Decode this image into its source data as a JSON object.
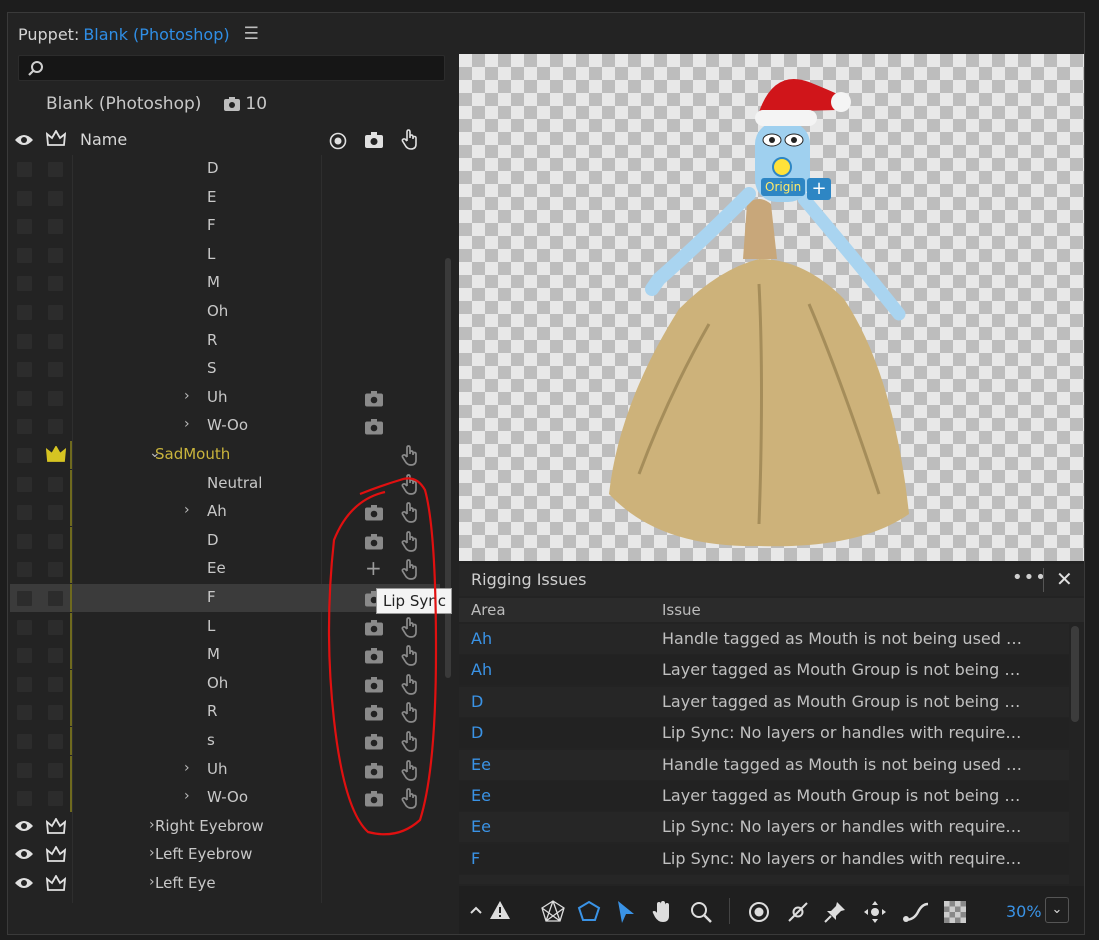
{
  "panel": {
    "title_prefix": "Puppet:",
    "title_link": "Blank (Photoshop)"
  },
  "search": {
    "placeholder": ""
  },
  "puppet": {
    "name": "Blank (Photoshop)",
    "count": "10"
  },
  "columns": {
    "name": "Name"
  },
  "layers": [
    {
      "name": "D",
      "indent": 3,
      "group": false,
      "expand": "",
      "cam": false,
      "hand": false,
      "plus": false,
      "eye": false,
      "crown": false,
      "yline": false,
      "sel": false
    },
    {
      "name": "E",
      "indent": 3,
      "group": false,
      "expand": "",
      "cam": false,
      "hand": false,
      "plus": false,
      "eye": false,
      "crown": false,
      "yline": false,
      "sel": false
    },
    {
      "name": "F",
      "indent": 3,
      "group": false,
      "expand": "",
      "cam": false,
      "hand": false,
      "plus": false,
      "eye": false,
      "crown": false,
      "yline": false,
      "sel": false
    },
    {
      "name": "L",
      "indent": 3,
      "group": false,
      "expand": "",
      "cam": false,
      "hand": false,
      "plus": false,
      "eye": false,
      "crown": false,
      "yline": false,
      "sel": false
    },
    {
      "name": "M",
      "indent": 3,
      "group": false,
      "expand": "",
      "cam": false,
      "hand": false,
      "plus": false,
      "eye": false,
      "crown": false,
      "yline": false,
      "sel": false
    },
    {
      "name": "Oh",
      "indent": 3,
      "group": false,
      "expand": "",
      "cam": false,
      "hand": false,
      "plus": false,
      "eye": false,
      "crown": false,
      "yline": false,
      "sel": false
    },
    {
      "name": "R",
      "indent": 3,
      "group": false,
      "expand": "",
      "cam": false,
      "hand": false,
      "plus": false,
      "eye": false,
      "crown": false,
      "yline": false,
      "sel": false
    },
    {
      "name": "S",
      "indent": 3,
      "group": false,
      "expand": "",
      "cam": false,
      "hand": false,
      "plus": false,
      "eye": false,
      "crown": false,
      "yline": false,
      "sel": false
    },
    {
      "name": "Uh",
      "indent": 3,
      "group": false,
      "expand": "›",
      "cam": true,
      "hand": false,
      "plus": false,
      "eye": false,
      "crown": false,
      "yline": false,
      "sel": false
    },
    {
      "name": "W-Oo",
      "indent": 3,
      "group": false,
      "expand": "›",
      "cam": true,
      "hand": false,
      "plus": false,
      "eye": false,
      "crown": false,
      "yline": false,
      "sel": false
    },
    {
      "name": "SadMouth",
      "indent": 2,
      "group": true,
      "expand": "⌄",
      "cam": false,
      "hand": true,
      "plus": false,
      "eye": false,
      "crown": true,
      "yline": true,
      "sel": false
    },
    {
      "name": "Neutral",
      "indent": 3,
      "group": false,
      "expand": "",
      "cam": false,
      "hand": true,
      "plus": false,
      "eye": false,
      "crown": false,
      "yline": true,
      "sel": false
    },
    {
      "name": "Ah",
      "indent": 3,
      "group": false,
      "expand": "›",
      "cam": true,
      "hand": true,
      "plus": false,
      "eye": false,
      "crown": false,
      "yline": true,
      "sel": false
    },
    {
      "name": "D",
      "indent": 3,
      "group": false,
      "expand": "",
      "cam": true,
      "hand": true,
      "plus": false,
      "eye": false,
      "crown": false,
      "yline": true,
      "sel": false
    },
    {
      "name": "Ee",
      "indent": 3,
      "group": false,
      "expand": "",
      "cam": false,
      "hand": true,
      "plus": true,
      "eye": false,
      "crown": false,
      "yline": true,
      "sel": false
    },
    {
      "name": "F",
      "indent": 3,
      "group": false,
      "expand": "",
      "cam": true,
      "hand": true,
      "plus": false,
      "eye": false,
      "crown": false,
      "yline": true,
      "sel": true
    },
    {
      "name": "L",
      "indent": 3,
      "group": false,
      "expand": "",
      "cam": true,
      "hand": true,
      "plus": false,
      "eye": false,
      "crown": false,
      "yline": true,
      "sel": false
    },
    {
      "name": "M",
      "indent": 3,
      "group": false,
      "expand": "",
      "cam": true,
      "hand": true,
      "plus": false,
      "eye": false,
      "crown": false,
      "yline": true,
      "sel": false
    },
    {
      "name": "Oh",
      "indent": 3,
      "group": false,
      "expand": "",
      "cam": true,
      "hand": true,
      "plus": false,
      "eye": false,
      "crown": false,
      "yline": true,
      "sel": false
    },
    {
      "name": "R",
      "indent": 3,
      "group": false,
      "expand": "",
      "cam": true,
      "hand": true,
      "plus": false,
      "eye": false,
      "crown": false,
      "yline": true,
      "sel": false
    },
    {
      "name": "s",
      "indent": 3,
      "group": false,
      "expand": "",
      "cam": true,
      "hand": true,
      "plus": false,
      "eye": false,
      "crown": false,
      "yline": true,
      "sel": false
    },
    {
      "name": "Uh",
      "indent": 3,
      "group": false,
      "expand": "›",
      "cam": true,
      "hand": true,
      "plus": false,
      "eye": false,
      "crown": false,
      "yline": true,
      "sel": false
    },
    {
      "name": "W-Oo",
      "indent": 3,
      "group": false,
      "expand": "›",
      "cam": true,
      "hand": true,
      "plus": false,
      "eye": false,
      "crown": false,
      "yline": true,
      "sel": false
    },
    {
      "name": "Right Eyebrow",
      "indent": 2,
      "group": false,
      "expand": "›",
      "cam": false,
      "hand": false,
      "plus": false,
      "eye": true,
      "crown": true,
      "yline": false,
      "sel": false
    },
    {
      "name": "Left Eyebrow",
      "indent": 2,
      "group": false,
      "expand": "›",
      "cam": false,
      "hand": false,
      "plus": false,
      "eye": true,
      "crown": true,
      "yline": false,
      "sel": false
    },
    {
      "name": "Left Eye",
      "indent": 2,
      "group": false,
      "expand": "›",
      "cam": false,
      "hand": false,
      "plus": false,
      "eye": true,
      "crown": true,
      "yline": false,
      "sel": false
    }
  ],
  "tooltip": {
    "text": "Lip Sync"
  },
  "canvas": {
    "origin_label": "Origin",
    "add_label": "+"
  },
  "rigging": {
    "title": "Rigging Issues",
    "menu": "•••",
    "close": "✕",
    "col_area": "Area",
    "col_issue": "Issue",
    "rows": [
      {
        "area": "Ah",
        "issue": "Handle tagged as Mouth is not being used by a…"
      },
      {
        "area": "Ah",
        "issue": "Layer tagged as Mouth Group is not being used…"
      },
      {
        "area": "D",
        "issue": "Layer tagged as Mouth Group is not being used…"
      },
      {
        "area": "D",
        "issue": "Lip Sync: No layers or handles with required ta…"
      },
      {
        "area": "Ee",
        "issue": "Handle tagged as Mouth is not being used by a…"
      },
      {
        "area": "Ee",
        "issue": "Layer tagged as Mouth Group is not being used…"
      },
      {
        "area": "Ee",
        "issue": "Lip Sync: No layers or handles with required ta…"
      },
      {
        "area": "F",
        "issue": "Lip Sync: No layers or handles with required ta…"
      },
      {
        "area": "",
        "issue": ""
      }
    ]
  },
  "toolbar": {
    "zoom": "30%",
    "zoom_menu": "⌄"
  },
  "colors": {
    "accent": "#2f8ee6",
    "group": "#c9b43c",
    "annotation": "#e01010"
  }
}
